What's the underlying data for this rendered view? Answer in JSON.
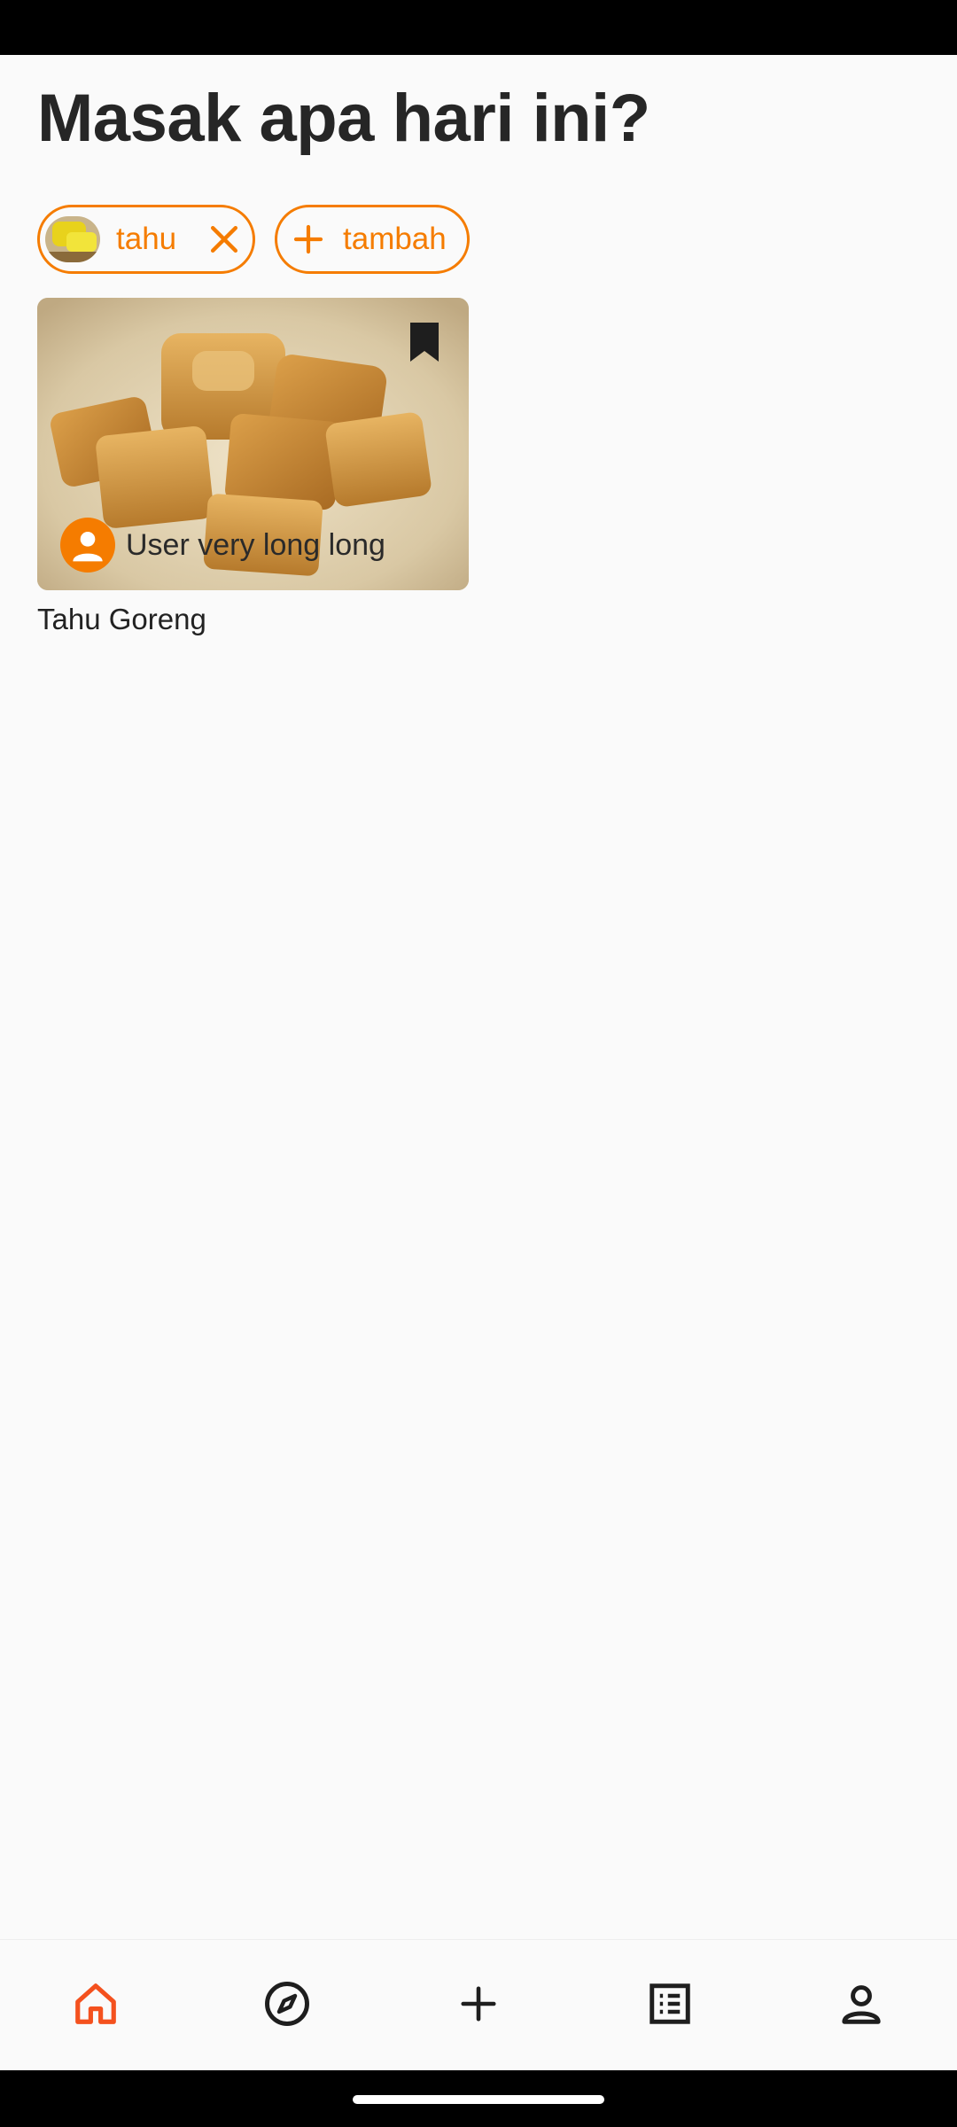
{
  "header": {
    "title": "Masak apa hari ini?"
  },
  "filters": {
    "active": [
      {
        "label": "tahu",
        "thumbnail": "tofu-thumbnail"
      }
    ],
    "add_label": "tambah"
  },
  "recipes": [
    {
      "title": "Tahu Goreng",
      "author": "User very long long",
      "image": "fried-tofu-photo",
      "bookmarked": true
    }
  ],
  "bottom_nav": {
    "items": [
      {
        "icon": "home-icon",
        "active": true
      },
      {
        "icon": "compass-icon",
        "active": false
      },
      {
        "icon": "plus-icon",
        "active": false
      },
      {
        "icon": "list-icon",
        "active": false
      },
      {
        "icon": "person-icon",
        "active": false
      }
    ]
  },
  "colors": {
    "accent": "#f57c00",
    "nav_active": "#f4511e",
    "background": "#fafafa",
    "text": "#212121"
  }
}
